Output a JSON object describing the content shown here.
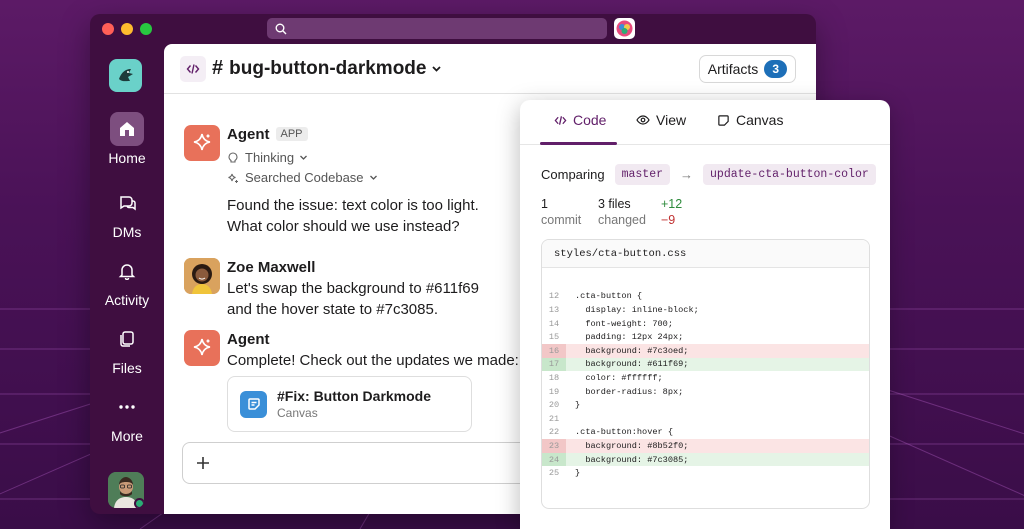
{
  "colors": {
    "brand_purple": "#3f0e40",
    "accent": "#611f69",
    "agent": "#e8715a",
    "badge_blue": "#1d6fb8",
    "add_green": "#2e8b3c",
    "del_red": "#c03030"
  },
  "sidebar": {
    "items": [
      {
        "label": "Home",
        "icon": "home-icon",
        "selected": true
      },
      {
        "label": "DMs",
        "icon": "dms-icon",
        "selected": false
      },
      {
        "label": "Activity",
        "icon": "bell-icon",
        "selected": false
      },
      {
        "label": "Files",
        "icon": "files-icon",
        "selected": false
      },
      {
        "label": "More",
        "icon": "more-icon",
        "selected": false
      }
    ]
  },
  "channel": {
    "hash": "#",
    "name": "bug-button-darkmode",
    "artifacts_label": "Artifacts",
    "artifacts_count": "3"
  },
  "messages": [
    {
      "author": "Agent",
      "badge": "APP",
      "steps": [
        "Thinking",
        "Searched Codebase"
      ],
      "lines": [
        "Found the issue: text color is too light.",
        "What color should we use instead?"
      ]
    },
    {
      "author": "Zoe Maxwell",
      "lines": [
        "Let's swap the background to #611f69",
        "and the hover state to #7c3085."
      ]
    },
    {
      "author": "Agent",
      "lines": [
        "Complete! Check out the updates we made:"
      ],
      "card": {
        "title": "#Fix: Button Darkmode",
        "subtitle": "Canvas"
      }
    }
  ],
  "panel": {
    "tabs": [
      {
        "label": "Code",
        "active": true
      },
      {
        "label": "View",
        "active": false
      },
      {
        "label": "Canvas",
        "active": false
      }
    ],
    "comparing": {
      "label": "Comparing",
      "base": "master",
      "head": "update-cta-button-color"
    },
    "stats": {
      "commits_n": "1",
      "commits_l": "commit",
      "files_n": "3 files",
      "files_l": "changed",
      "added": "+12",
      "removed": "−9"
    },
    "file": "styles/cta-button.css",
    "lines": [
      {
        "n": "",
        "code": "",
        "t": "ctx"
      },
      {
        "n": "12",
        "code": ".cta-button {",
        "t": "ctx"
      },
      {
        "n": "13",
        "code": "  display: inline-block;",
        "t": "ctx"
      },
      {
        "n": "14",
        "code": "  font-weight: 700;",
        "t": "ctx"
      },
      {
        "n": "15",
        "code": "  padding: 12px 24px;",
        "t": "ctx"
      },
      {
        "n": "16",
        "code": "  background: #7c3oed;",
        "t": "del"
      },
      {
        "n": "17",
        "code": "  background: #611f69;",
        "t": "add"
      },
      {
        "n": "18",
        "code": "  color: #ffffff;",
        "t": "ctx"
      },
      {
        "n": "19",
        "code": "  border-radius: 8px;",
        "t": "ctx"
      },
      {
        "n": "20",
        "code": "}",
        "t": "ctx"
      },
      {
        "n": "21",
        "code": "",
        "t": "ctx"
      },
      {
        "n": "22",
        "code": ".cta-button:hover {",
        "t": "ctx"
      },
      {
        "n": "23",
        "code": "  background: #8b52f0;",
        "t": "del"
      },
      {
        "n": "24",
        "code": "  background: #7c3085;",
        "t": "add"
      },
      {
        "n": "25",
        "code": "}",
        "t": "ctx"
      }
    ]
  }
}
